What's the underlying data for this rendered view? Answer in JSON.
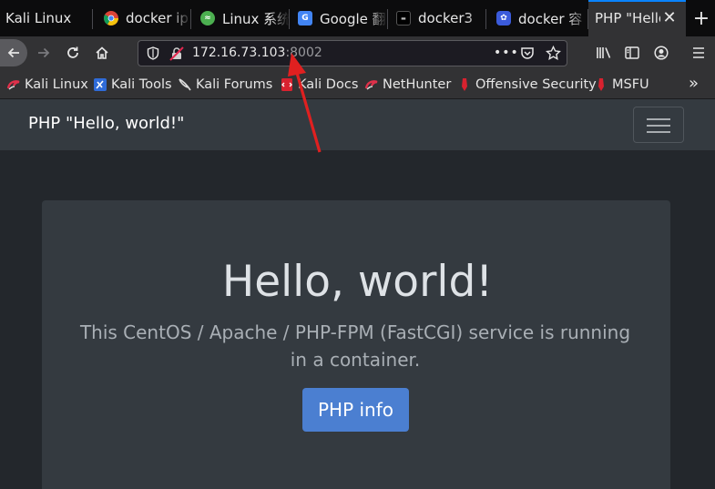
{
  "browser": {
    "tabs": [
      {
        "title": "Kali Linux",
        "icon": "kali-icon"
      },
      {
        "title": "docker ip",
        "icon": "chrome-icon"
      },
      {
        "title": "Linux 系统",
        "icon": "linux-site-icon"
      },
      {
        "title": "Google 翻",
        "icon": "google-translate-icon"
      },
      {
        "title": "docker3",
        "icon": "docker3-icon"
      },
      {
        "title": "docker 容",
        "icon": "baidu-icon"
      },
      {
        "title": "PHP \"Hello",
        "icon": "none",
        "active": true
      }
    ],
    "address": {
      "host": "172.16.73.103",
      "port": ":8002"
    },
    "bookmarks": [
      {
        "label": "Kali Linux",
        "icon": "kali-dragon-icon"
      },
      {
        "label": "Kali Tools",
        "icon": "kali-tools-icon"
      },
      {
        "label": "Kali Forums",
        "icon": "kali-forums-icon"
      },
      {
        "label": "Kali Docs",
        "icon": "kali-docs-icon"
      },
      {
        "label": "NetHunter",
        "icon": "nethunter-icon"
      },
      {
        "label": "Offensive Security",
        "icon": "offsec-icon"
      },
      {
        "label": "MSFU",
        "icon": "msfu-icon"
      }
    ]
  },
  "page": {
    "brand": "PHP \"Hello, world!\"",
    "heading": "Hello, world!",
    "lead": "This CentOS / Apache / PHP-FPM (FastCGI) service is running in a container.",
    "button": "PHP info"
  },
  "colors": {
    "accent": "#0a84ff",
    "button": "#4b7fd1",
    "annotation_arrow": "#e02020"
  }
}
